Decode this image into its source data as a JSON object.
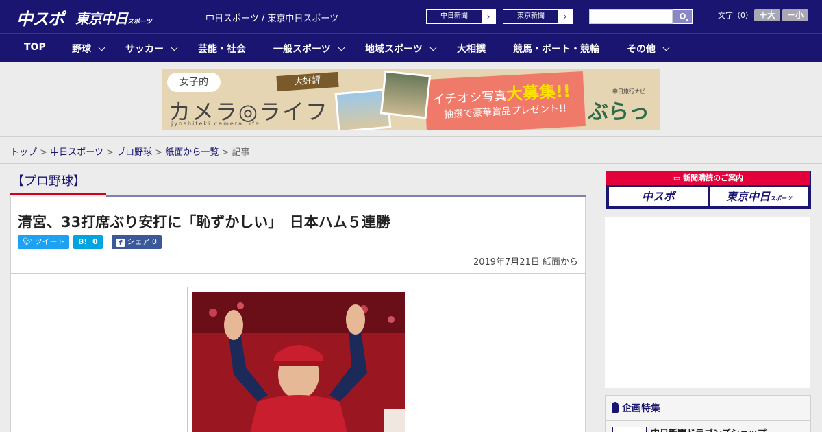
{
  "header": {
    "logo_primary": "中スポ",
    "logo_secondary": "東京中日",
    "logo_secondary_small": "スポーツ",
    "site_title": "中日スポーツ / 東京中日スポーツ",
    "paper_links": [
      "中日新聞",
      "東京新聞"
    ],
    "search": {
      "placeholder": "",
      "button_icon": "search-icon"
    },
    "font_size": {
      "label": "文字（0）",
      "increase": "＋大",
      "decrease": "－小"
    }
  },
  "nav": {
    "items": [
      {
        "label": "TOP",
        "dropdown": false
      },
      {
        "label": "野球",
        "dropdown": true
      },
      {
        "label": "サッカー",
        "dropdown": true
      },
      {
        "label": "芸能・社会",
        "dropdown": false
      },
      {
        "label": "一般スポーツ",
        "dropdown": true
      },
      {
        "label": "地域スポーツ",
        "dropdown": true
      },
      {
        "label": "大相撲",
        "dropdown": false
      },
      {
        "label": "競馬・ボート・競輪",
        "dropdown": false
      },
      {
        "label": "その他",
        "dropdown": true
      }
    ]
  },
  "banner": {
    "tag": "女子的",
    "title": "カメラ◎ライフ",
    "subtitle": "jyoshiteki camera life",
    "badge": "大好評",
    "headline_prefix": "イチオシ写真",
    "headline_em": "大募集!!",
    "lottery": "抽選で豪華賞品プレゼント!!",
    "brand_small": "中日旅行ナビ",
    "brand": "ぶらっ人"
  },
  "breadcrumb": {
    "items": [
      "トップ",
      "中日スポーツ",
      "プロ野球",
      "紙面から一覧"
    ],
    "current": "記事",
    "separator": ">"
  },
  "article": {
    "category": "【プロ野球】",
    "headline": "清宮、33打席ぶり安打に「恥ずかしい」　日本ハム５連勝",
    "share": {
      "tweet": "ツイート",
      "hatena_label": "B!",
      "hatena_count": "0",
      "facebook_label": "シェア",
      "facebook_count": "0"
    },
    "date": "2019年7月21日",
    "source": "紙面から"
  },
  "sidebar": {
    "subscription_title": "新聞購読のご案内",
    "subscription_buttons": [
      "中スポ",
      "東京中日"
    ],
    "subscription_button_small": "スポーツ",
    "feature_title": "企画特集",
    "feature_item": "中日新聞ドラゴンズショップ"
  },
  "colors": {
    "brand_navy": "#1a1570",
    "accent_red": "#d0021b",
    "twitter": "#1da1f2",
    "hatena": "#00a4de",
    "facebook": "#3b5998"
  }
}
